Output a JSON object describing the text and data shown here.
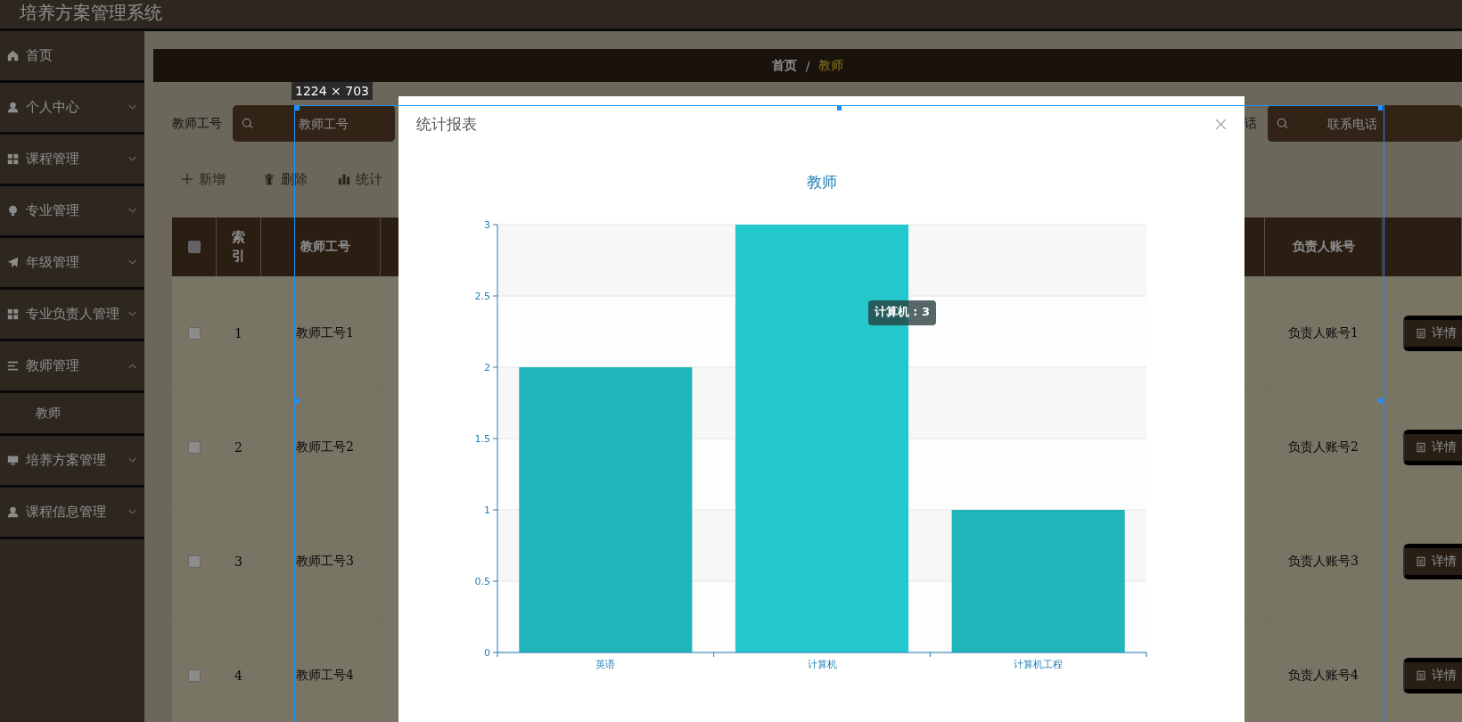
{
  "app": {
    "title": "培养方案管理系统"
  },
  "sidebar": {
    "items": [
      {
        "label": "首页",
        "kind": "link"
      },
      {
        "label": "个人中心",
        "kind": "group",
        "expanded": false
      },
      {
        "label": "课程管理",
        "kind": "group",
        "expanded": false
      },
      {
        "label": "专业管理",
        "kind": "group",
        "expanded": false
      },
      {
        "label": "年级管理",
        "kind": "group",
        "expanded": false
      },
      {
        "label": "专业负责人管理",
        "kind": "group",
        "expanded": false
      },
      {
        "label": "教师管理",
        "kind": "group",
        "expanded": true,
        "children": [
          {
            "label": "教师"
          }
        ]
      },
      {
        "label": "培养方案管理",
        "kind": "group",
        "expanded": false
      },
      {
        "label": "课程信息管理",
        "kind": "group",
        "expanded": false
      }
    ]
  },
  "breadcrumb": {
    "separator": "/",
    "items": [
      {
        "label": "首页",
        "current": false
      },
      {
        "label": "教师",
        "current": true
      }
    ]
  },
  "search": {
    "fields": [
      {
        "label": "教师工号",
        "placeholder": "教师工号"
      },
      {
        "label": "话",
        "placeholder": "联系电话"
      }
    ]
  },
  "toolbar": {
    "buttons": [
      {
        "label": "新增"
      },
      {
        "label": "删除"
      },
      {
        "label": "统计"
      }
    ]
  },
  "table": {
    "select_all_checked": false,
    "columns": [
      {
        "label": "索引"
      },
      {
        "label": "教师工号"
      },
      {
        "label": "负责人账号"
      }
    ],
    "rows": [
      {
        "checked": false,
        "index": "1",
        "teacher_id": "教师工号1",
        "account": "负责人账号1",
        "action": "详情"
      },
      {
        "checked": false,
        "index": "2",
        "teacher_id": "教师工号2",
        "account": "负责人账号2",
        "action": "详情"
      },
      {
        "checked": false,
        "index": "3",
        "teacher_id": "教师工号3",
        "account": "负责人账号3",
        "action": "详情"
      },
      {
        "checked": false,
        "index": "4",
        "teacher_id": "教师工号4",
        "account": "负责人账号4",
        "action": "详情"
      }
    ]
  },
  "modal": {
    "title": "统计报表",
    "chart_data": {
      "type": "bar",
      "title": "教师",
      "categories": [
        "英语",
        "计算机",
        "计算机工程"
      ],
      "series": [
        {
          "color": "#20b6b9",
          "values": [
            2,
            3,
            1
          ]
        }
      ],
      "ylim": [
        0,
        3
      ],
      "yticks": [
        0,
        0.5,
        1,
        1.5,
        2,
        2.5,
        3
      ],
      "grid": true,
      "annotations": [
        "计算机 : 3"
      ]
    }
  },
  "capture": {
    "size_label": "1224 × 703"
  }
}
